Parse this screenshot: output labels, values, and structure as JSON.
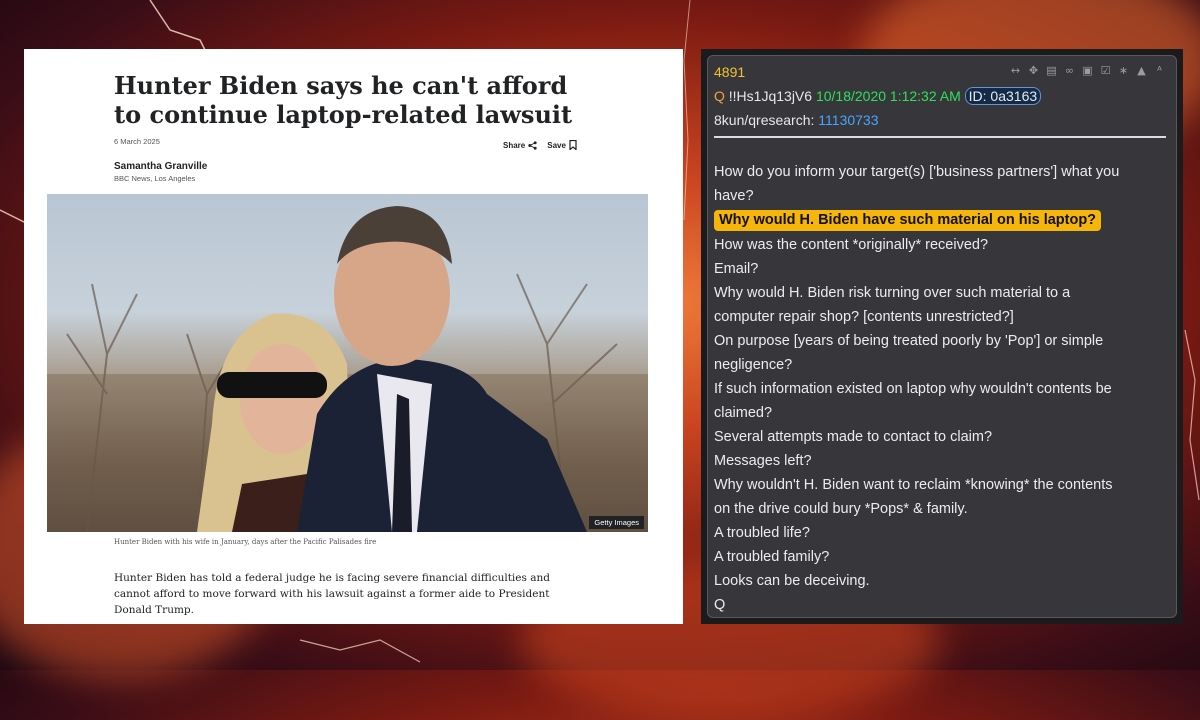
{
  "article": {
    "headline": "Hunter Biden says he can't afford to continue laptop-related lawsuit",
    "date": "6 March 2025",
    "share_label": "Share",
    "save_label": "Save",
    "author": "Samantha Granville",
    "author_org": "BBC News, Los Angeles",
    "photo_credit": "Getty Images",
    "caption": "Hunter Biden with his wife in January, days after the Pacific Palisades fire",
    "lede": "Hunter Biden has told a federal judge he is facing severe financial difficulties and cannot afford to move forward with his lawsuit against a former aide to President Donald Trump."
  },
  "qpost": {
    "number": "4891",
    "q_letter": "Q",
    "tripcode": "!!Hs1Jq13jV6",
    "datetime": "10/18/2020 1:12:32 AM",
    "id_label": "ID: 0a3163",
    "board": "8kun/qresearch:",
    "post_number": "11130733",
    "icons": [
      "resize-icon",
      "move-icon",
      "document-icon",
      "glasses-icon",
      "archive-icon",
      "clipboard-icon",
      "share-icon",
      "up-arrow-icon",
      "text-size-icon"
    ],
    "lines": [
      "How do you inform your target(s) ['business partners'] what you",
      "have?",
      "Why would H. Biden have such material on his laptop?",
      "How was the content *originally* received?",
      "Email?",
      "Why would H. Biden risk turning over such material to a",
      "computer repair shop? [contents unrestricted?]",
      "On purpose [years of being treated poorly by 'Pop'] or simple",
      "negligence?",
      "If such information existed on laptop why wouldn't contents be",
      "claimed?",
      "Several attempts made to contact to claim?",
      "Messages left?",
      "Why wouldn't H. Biden want to reclaim *knowing* the contents",
      "on the drive could bury *Pops* & family.",
      "A troubled life?",
      "A troubled family?",
      "Looks can be deceiving.",
      "Q"
    ]
  },
  "colors": {
    "highlight": "#f5b50a",
    "post_number_yellow": "#f2c230",
    "date_green": "#2ee05a",
    "link_blue": "#4aa3ff"
  }
}
